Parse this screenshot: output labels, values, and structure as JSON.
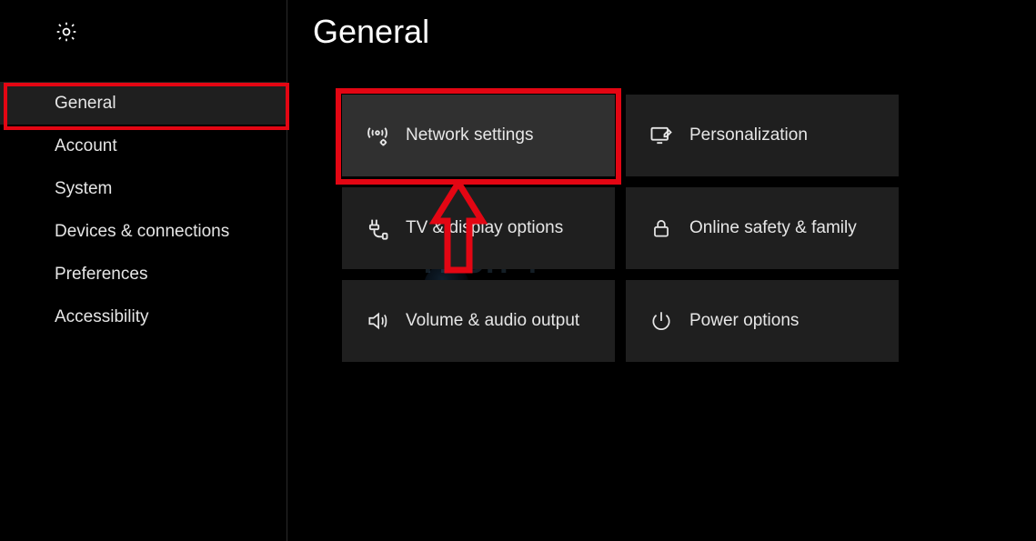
{
  "header": {
    "title": "General"
  },
  "sidebar": {
    "items": [
      {
        "label": "General",
        "selected": true
      },
      {
        "label": "Account"
      },
      {
        "label": "System"
      },
      {
        "label": "Devices & connections"
      },
      {
        "label": "Preferences"
      },
      {
        "label": "Accessibility"
      }
    ]
  },
  "tiles": [
    {
      "label": "Network settings",
      "icon": "antenna-gear-icon",
      "selected": true
    },
    {
      "label": "Personalization",
      "icon": "personalize-icon"
    },
    {
      "label": "TV & display options",
      "icon": "cable-icon"
    },
    {
      "label": "Online safety & family",
      "icon": "lock-icon"
    },
    {
      "label": "Volume & audio output",
      "icon": "speaker-icon"
    },
    {
      "label": "Power options",
      "icon": "power-icon"
    }
  ],
  "watermark": {
    "line1": "TECH 4",
    "line2": "GAMERS"
  },
  "annotations": {
    "highlight_sidebar_item": 0,
    "highlight_tile": 0,
    "arrow_points_to_tile": 0
  }
}
